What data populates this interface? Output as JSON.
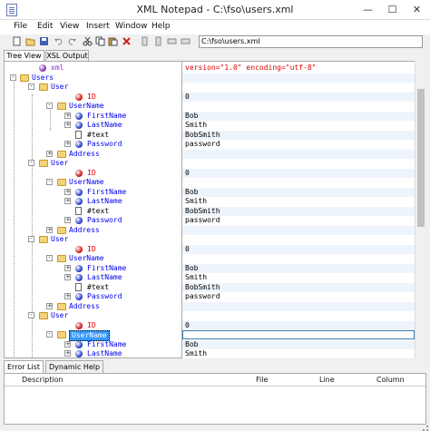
{
  "window": {
    "title": "XML Notepad - C:\\fso\\users.xml",
    "minimize": "—",
    "maximize": "☐",
    "close": "✕"
  },
  "menu": [
    "File",
    "Edit",
    "View",
    "Insert",
    "Window",
    "Help"
  ],
  "toolbar": {
    "path": "C:\\fso\\users.xml"
  },
  "tabs": [
    "Tree View",
    "XSL Output"
  ],
  "tree": [
    {
      "label": "xml",
      "kind": "pi",
      "depth": 1,
      "toggle": ""
    },
    {
      "label": "Users",
      "kind": "folder",
      "depth": 0,
      "toggle": "-"
    },
    {
      "label": "User",
      "kind": "folder",
      "depth": 1,
      "toggle": "-"
    },
    {
      "label": "ID",
      "kind": "attr",
      "depth": 3,
      "toggle": ""
    },
    {
      "label": "UserName",
      "kind": "folder",
      "depth": 2,
      "toggle": "-"
    },
    {
      "label": "FirstName",
      "kind": "elem",
      "depth": 3,
      "toggle": "+"
    },
    {
      "label": "LastName",
      "kind": "elem",
      "depth": 3,
      "toggle": "+"
    },
    {
      "label": "#text",
      "kind": "text",
      "depth": 3,
      "toggle": ""
    },
    {
      "label": "Password",
      "kind": "elem",
      "depth": 3,
      "toggle": "+"
    },
    {
      "label": "Address",
      "kind": "folder",
      "depth": 2,
      "toggle": "+"
    },
    {
      "label": "User",
      "kind": "folder",
      "depth": 1,
      "toggle": "-"
    },
    {
      "label": "ID",
      "kind": "attr",
      "depth": 3,
      "toggle": ""
    },
    {
      "label": "UserName",
      "kind": "folder",
      "depth": 2,
      "toggle": "-"
    },
    {
      "label": "FirstName",
      "kind": "elem",
      "depth": 3,
      "toggle": "+"
    },
    {
      "label": "LastName",
      "kind": "elem",
      "depth": 3,
      "toggle": "+"
    },
    {
      "label": "#text",
      "kind": "text",
      "depth": 3,
      "toggle": ""
    },
    {
      "label": "Password",
      "kind": "elem",
      "depth": 3,
      "toggle": "+"
    },
    {
      "label": "Address",
      "kind": "folder",
      "depth": 2,
      "toggle": "+"
    },
    {
      "label": "User",
      "kind": "folder",
      "depth": 1,
      "toggle": "-"
    },
    {
      "label": "ID",
      "kind": "attr",
      "depth": 3,
      "toggle": ""
    },
    {
      "label": "UserName",
      "kind": "folder",
      "depth": 2,
      "toggle": "-"
    },
    {
      "label": "FirstName",
      "kind": "elem",
      "depth": 3,
      "toggle": "+"
    },
    {
      "label": "LastName",
      "kind": "elem",
      "depth": 3,
      "toggle": "+"
    },
    {
      "label": "#text",
      "kind": "text",
      "depth": 3,
      "toggle": ""
    },
    {
      "label": "Password",
      "kind": "elem",
      "depth": 3,
      "toggle": "+"
    },
    {
      "label": "Address",
      "kind": "folder",
      "depth": 2,
      "toggle": "+"
    },
    {
      "label": "User",
      "kind": "folder",
      "depth": 1,
      "toggle": "-"
    },
    {
      "label": "ID",
      "kind": "attr",
      "depth": 3,
      "toggle": ""
    },
    {
      "label": "UserName",
      "kind": "folder",
      "depth": 2,
      "toggle": "-",
      "selected": true
    },
    {
      "label": "FirstName",
      "kind": "elem",
      "depth": 3,
      "toggle": "+"
    },
    {
      "label": "LastName",
      "kind": "elem",
      "depth": 3,
      "toggle": "+"
    }
  ],
  "values": [
    {
      "text": "version=\"1.0\" encoding=\"utf-8\"",
      "kind": "pi"
    },
    {
      "text": ""
    },
    {
      "text": ""
    },
    {
      "text": "0"
    },
    {
      "text": ""
    },
    {
      "text": "Bob"
    },
    {
      "text": "Smith"
    },
    {
      "text": "BobSmith"
    },
    {
      "text": "password"
    },
    {
      "text": ""
    },
    {
      "text": ""
    },
    {
      "text": "0"
    },
    {
      "text": ""
    },
    {
      "text": "Bob"
    },
    {
      "text": "Smith"
    },
    {
      "text": "BobSmith"
    },
    {
      "text": "password"
    },
    {
      "text": ""
    },
    {
      "text": ""
    },
    {
      "text": "0"
    },
    {
      "text": ""
    },
    {
      "text": "Bob"
    },
    {
      "text": "Smith"
    },
    {
      "text": "BobSmith"
    },
    {
      "text": "password"
    },
    {
      "text": ""
    },
    {
      "text": ""
    },
    {
      "text": "0"
    },
    {
      "text": "",
      "edit": true
    },
    {
      "text": "Bob"
    },
    {
      "text": "Smith"
    }
  ],
  "bottom_tabs": [
    "Error List",
    "Dynamic Help"
  ],
  "error_columns": [
    "Description",
    "File",
    "Line",
    "Column"
  ]
}
